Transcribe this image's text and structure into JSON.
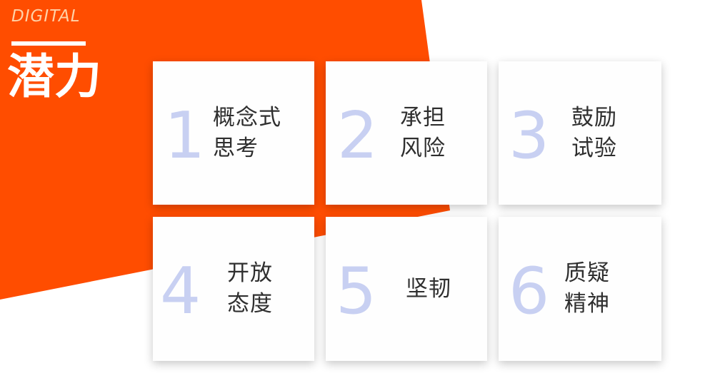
{
  "header": {
    "eyebrow": "DIGITAL",
    "title": "潜力"
  },
  "colors": {
    "accent": "#ff4d00",
    "card_number": "#c8d0f2",
    "card_text": "#2f2f2f"
  },
  "cards": [
    {
      "number": "1",
      "label": "概念式\n思考"
    },
    {
      "number": "2",
      "label": "承担\n风险"
    },
    {
      "number": "3",
      "label": "鼓励\n试验"
    },
    {
      "number": "4",
      "label": "开放\n态度"
    },
    {
      "number": "5",
      "label": "坚韧"
    },
    {
      "number": "6",
      "label": "质疑\n精神"
    }
  ]
}
